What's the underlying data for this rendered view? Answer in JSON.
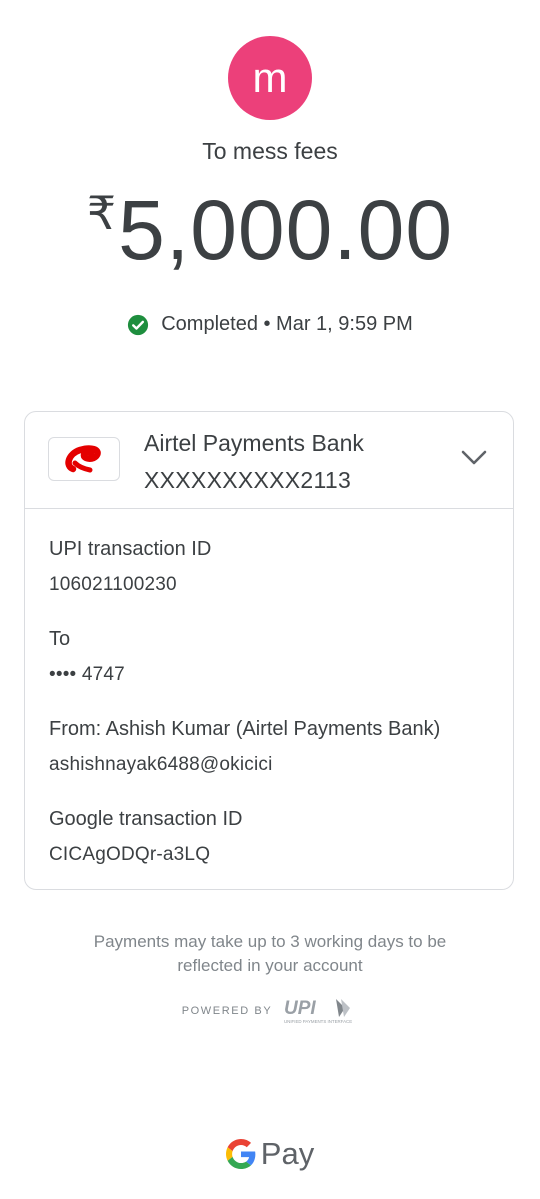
{
  "payee": {
    "avatar_letter": "m",
    "avatar_color": "#ec407a",
    "label": "To mess fees"
  },
  "amount": {
    "currency_symbol": "₹",
    "value": "5,000.00"
  },
  "status": {
    "text": "Completed • Mar 1, 9:59 PM",
    "icon": "check-circle-icon",
    "color": "#1e8e3e"
  },
  "bank": {
    "name": "Airtel Payments Bank",
    "account": "XXXXXXXXXX2113",
    "logo": "airtel-logo",
    "logo_color": "#e40000"
  },
  "details": [
    {
      "label": "UPI transaction ID",
      "value": "106021100230"
    },
    {
      "label": "To",
      "value": "•••• 4747"
    },
    {
      "label": "From: Ashish  Kumar (Airtel Payments Bank)",
      "value": "ashishnayak6488@okicici"
    },
    {
      "label": "Google transaction ID",
      "value": "CICAgODQr-a3LQ"
    }
  ],
  "footer": {
    "note": "Payments may take up to 3 working days to be reflected in your account",
    "powered_by": "POWERED BY",
    "upi_logo_text": "UPI",
    "upi_tagline": "UNIFIED PAYMENTS INTERFACE",
    "brand": "Pay"
  }
}
